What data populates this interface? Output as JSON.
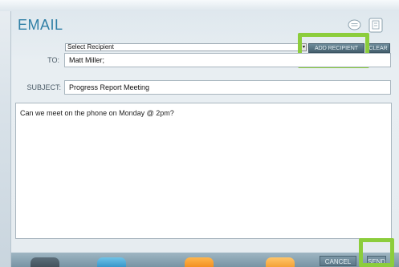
{
  "window": {
    "title": "EMAIL"
  },
  "icons": {
    "chat": "chat-bubble-icon",
    "note": "note-icon"
  },
  "recipient": {
    "select_value": "Select Recipient",
    "add_label": "ADD RECIPIENT",
    "clear_label": "CLEAR"
  },
  "to": {
    "label": "TO:",
    "value": "Matt Miller;"
  },
  "subject": {
    "label": "SUBJECT:",
    "value": "Progress Report Meeting"
  },
  "message": {
    "body": "Can we meet on the phone on Monday @ 2pm?"
  },
  "actions": {
    "cancel_label": "CANCEL",
    "send_label": "SEND"
  },
  "colors": {
    "title": "#2f7fa6",
    "highlight": "#8ccd3c",
    "button": "#46616f"
  }
}
